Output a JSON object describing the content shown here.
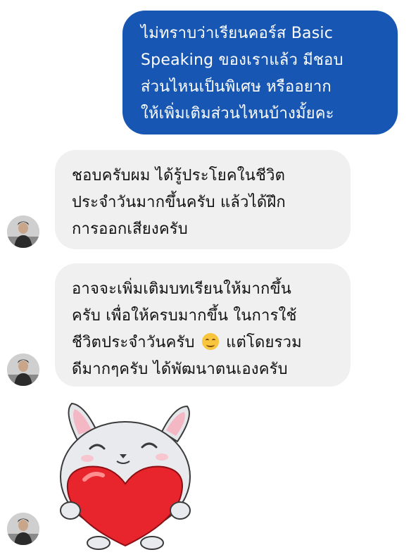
{
  "conversation": {
    "outgoing_message": {
      "lines": [
        "ไม่ทราบว่าเรียนคอร์ส Basic",
        "Speaking ของเราแล้ว มีชอบ",
        "ส่วนไหนเป็นพิเศษ หรืออยาก",
        "ให้เพิ่มเติมส่วนไหนบ้างมั้ยคะ"
      ]
    },
    "incoming_message_1": {
      "lines": [
        "ชอบครับผม ได้รู้ประโยคในชีวิต",
        "ประจำวันมากขึ้นครับ แล้วได้ฝึก",
        "การออกเสียงครับ"
      ]
    },
    "incoming_message_2": {
      "line1": "อาจจะเพิ่มเติมบทเรียนให้มากขึ้น",
      "line2": "ครับ เพื่อให้ครบมากขึ้น ในการใช้",
      "line3_before_emoji": "ชีวิตประจำวันครับ",
      "line3_after_emoji": "แต่โดยรวม",
      "line4": "ดีมากๆครับ ได้พัฒนาตนเองครับ",
      "emoji": "smiling-face-emoji"
    },
    "sticker": "bunny-hugging-heart-sticker",
    "colors": {
      "outgoing_bubble": "#1757b3",
      "incoming_bubble": "#f0f0f0",
      "heart": "#e8252c"
    }
  }
}
